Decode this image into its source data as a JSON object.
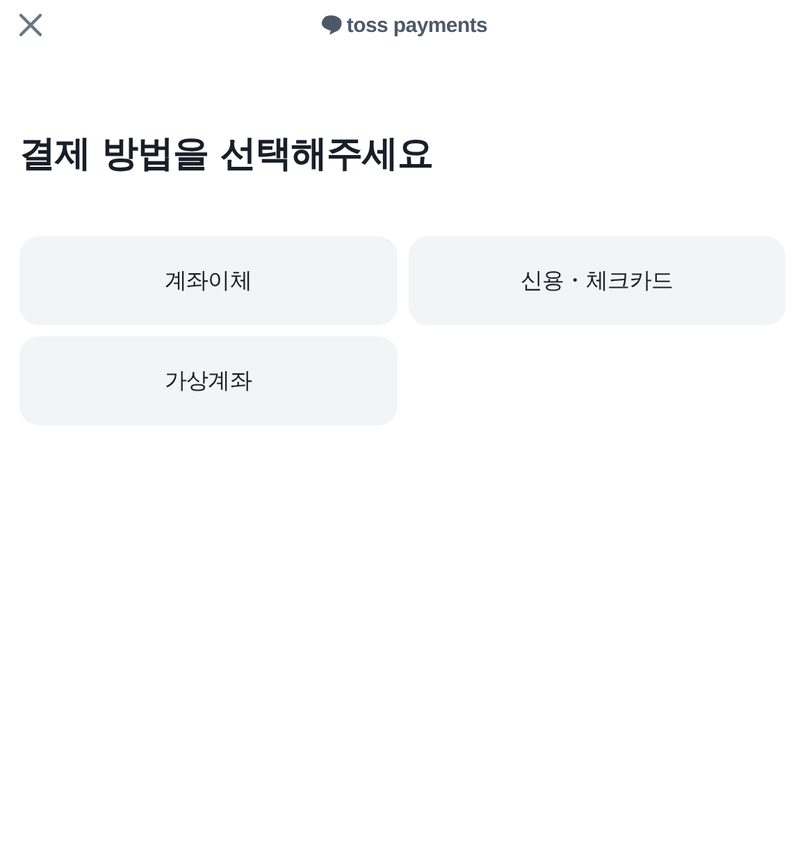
{
  "header": {
    "logo": "toss payments"
  },
  "title": "결제 방법을 선택해주세요",
  "methods": [
    {
      "label": "계좌이체"
    },
    {
      "label": "신용・체크카드"
    },
    {
      "label": "가상계좌"
    }
  ]
}
